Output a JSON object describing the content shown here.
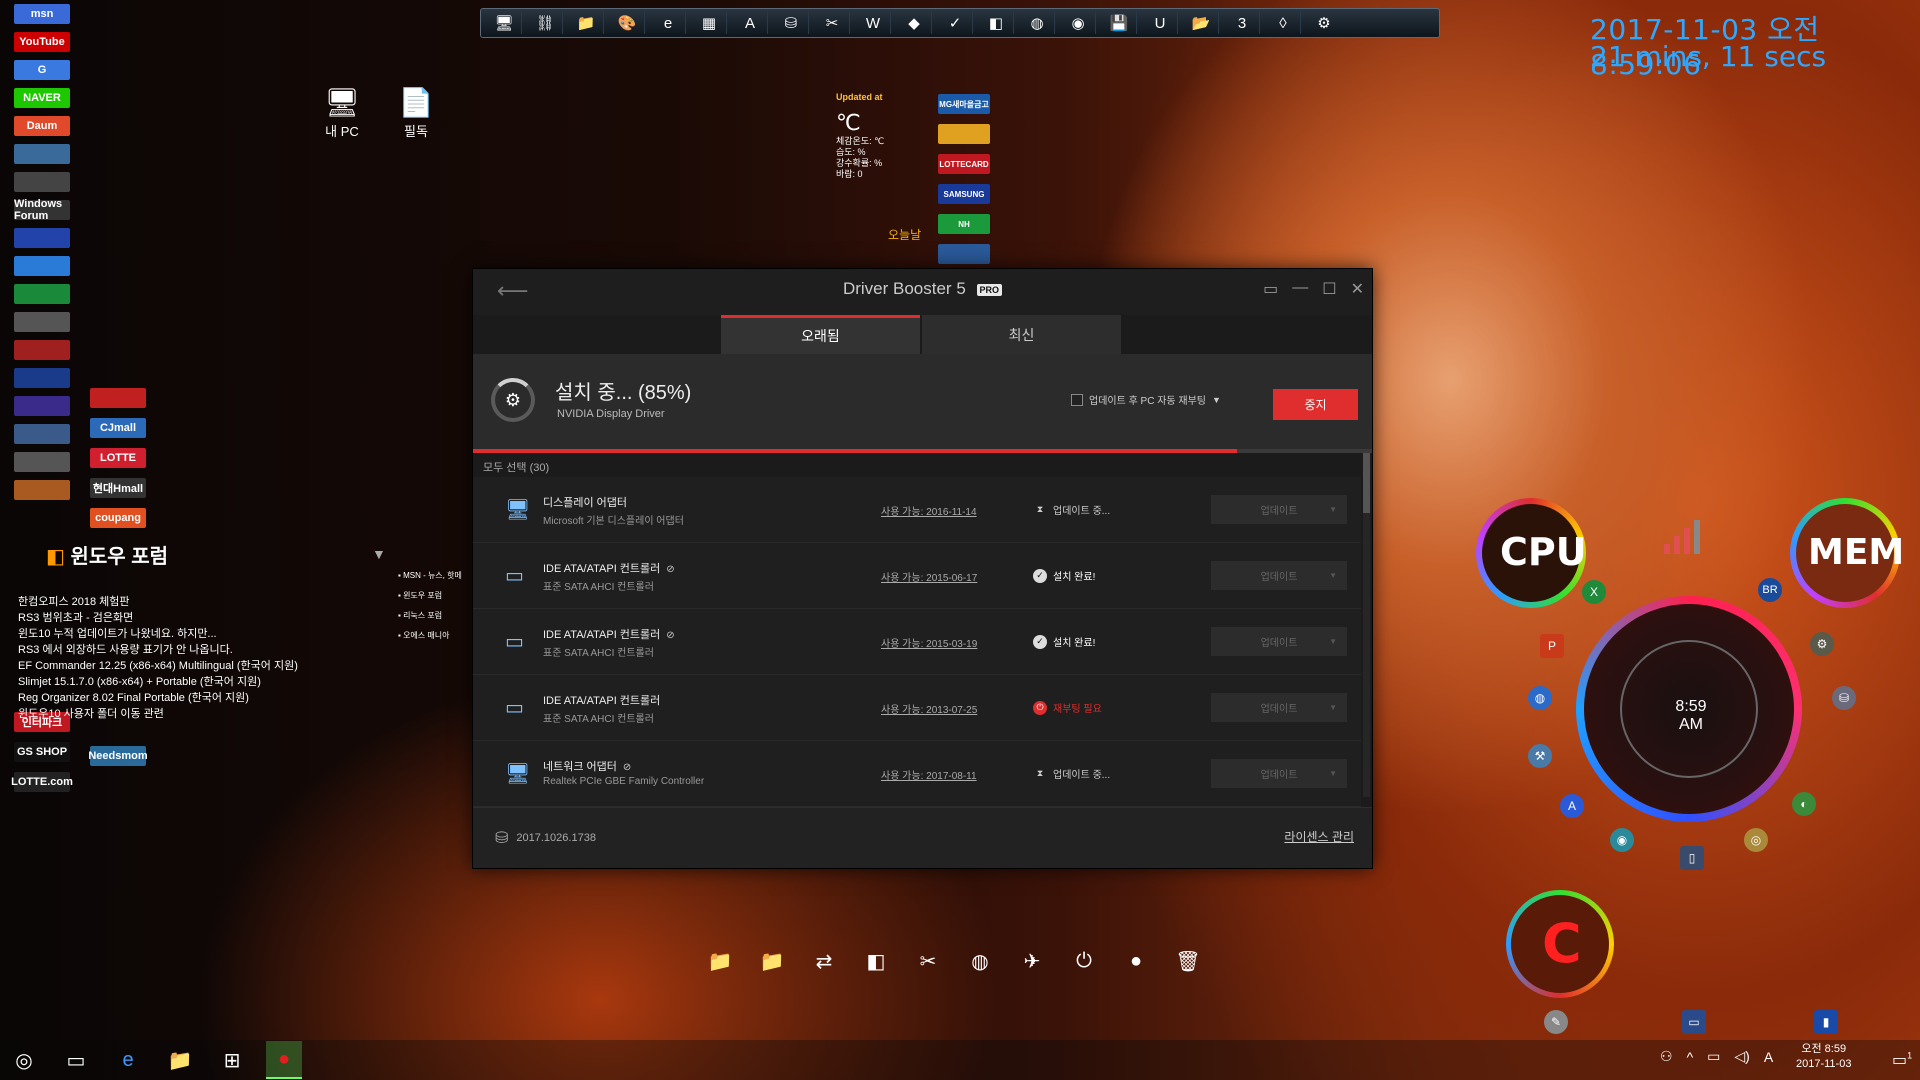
{
  "clock": {
    "datetime": "2017-11-03 오전 8:59:06",
    "uptime": "21 mins, 11 secs"
  },
  "top_toolbar": {
    "icons": [
      "monitor-icon",
      "network-icon",
      "folder-icon",
      "palette-icon",
      "ie-icon",
      "calendar-icon",
      "avast-icon",
      "drive-icon",
      "tools-icon",
      "word-icon",
      "diamond-icon",
      "check-icon",
      "rss-icon",
      "globe-icon",
      "eye-icon",
      "floppy-icon",
      "u-icon",
      "folder-open-icon",
      "calendar3-icon",
      "drop-icon",
      "gear-icon"
    ]
  },
  "left_dock": {
    "logos": [
      {
        "label": "msn",
        "color": "#3a6ad8"
      },
      {
        "label": "YouTube",
        "color": "#cc0000"
      },
      {
        "label": "G",
        "color": "#3a7ae0"
      },
      {
        "label": "NAVER",
        "color": "#1ec800"
      },
      {
        "label": "Daum",
        "color": "#e04a2a"
      },
      {
        "label": "",
        "color": "#3a6a9a"
      },
      {
        "label": "",
        "color": "#444"
      },
      {
        "label": "Windows Forum",
        "color": "#333"
      },
      {
        "label": "",
        "color": "#2244aa"
      },
      {
        "label": "",
        "color": "#2a7ad8"
      },
      {
        "label": "",
        "color": "#1a8a3a"
      },
      {
        "label": "",
        "color": "#555"
      },
      {
        "label": "",
        "color": "#a02020"
      },
      {
        "label": "",
        "color": "#1a3a8a"
      },
      {
        "label": "",
        "color": "#3a2a8a"
      },
      {
        "label": "",
        "color": "#3a5a8a"
      },
      {
        "label": "",
        "color": "#555"
      },
      {
        "label": "",
        "color": "#a85a20"
      }
    ],
    "logos_right": [
      {
        "label": "",
        "color": "#c02020"
      },
      {
        "label": "CJmall",
        "color": "#2a6ab8"
      },
      {
        "label": "LOTTE",
        "color": "#d02030"
      },
      {
        "label": "현대Hmall",
        "color": "#333"
      },
      {
        "label": "coupang",
        "color": "#e05020"
      }
    ],
    "logos_bottom": [
      {
        "label": "인터파크",
        "color": "#c01820"
      },
      {
        "label": "GS SHOP",
        "color": "#111"
      },
      {
        "label": "LOTTE.com",
        "color": "#222"
      }
    ],
    "logos_bottom_right": [
      {
        "label": "Needsmom",
        "color": "#2a6a9a"
      }
    ]
  },
  "desktop_icons": [
    {
      "label": "내 PC",
      "icon": "monitor-icon"
    },
    {
      "label": "필독",
      "icon": "document-icon"
    }
  ],
  "weather": {
    "updated_label": "Updated at",
    "temp": "℃",
    "lines": [
      "체감온도: ℃",
      "습도: %",
      "강수확률: %",
      "바람:  0"
    ],
    "today_label": "오늘날"
  },
  "bank_logos": [
    {
      "label": "MG새마을금고",
      "color": "#1a5aa8"
    },
    {
      "label": "",
      "color": "#e0a020"
    },
    {
      "label": "LOTTECARD",
      "color": "#c01820"
    },
    {
      "label": "SAMSUNG",
      "color": "#1a3a9a"
    },
    {
      "label": "NH",
      "color": "#1a9a3a"
    },
    {
      "label": "",
      "color": "#2a5a9a"
    }
  ],
  "rss": {
    "title": "윈도우 포럼",
    "items": [
      "한컴오피스 2018 체험판",
      "RS3 범위초과 - 검은화면",
      "윈도10 누적 업데이트가 나왔네요. 하지만...",
      "RS3 에서 외장하드 사용량 표기가 안 나옵니다.",
      "EF Commander 12.25 (x86-x64) Multilingual (한국어 지원)",
      "Slimjet 15.1.7.0 (x86-x64) + Portable (한국어 지원)",
      "Reg Organizer 8.02 Final Portable (한국어 지원)",
      "윈도우10 사용자 폴더 이동 관련"
    ],
    "side_items": [
      "MSN - 뉴스, 핫메",
      "윈도우 포럼",
      "리눅스 포럼",
      "오에스 매니아"
    ]
  },
  "app": {
    "title": "Driver Booster 5",
    "pro": "PRO",
    "tabs": [
      {
        "label": "오래됨",
        "active": true
      },
      {
        "label": "최신",
        "active": false
      }
    ],
    "status_main": "설치 중... (85%)",
    "status_sub": "NVIDIA Display Driver",
    "restart_option": "업데이트 후 PC 자동 재부팅",
    "stop_label": "중지",
    "progress_percent": 85,
    "select_all": "모두 선택 (30)",
    "rows": [
      {
        "name": "디스플레이 어댑터",
        "tagged": false,
        "desc": "Microsoft 기본 디스플레이 어댑터",
        "avail": "사용 가능: 2016-11-14",
        "status": "업데이트 중...",
        "status_type": "updating",
        "btn": "업데이트",
        "icon": "display-adapter-icon"
      },
      {
        "name": "IDE ATA/ATAPI 컨트롤러",
        "tagged": true,
        "desc": "표준 SATA AHCI 컨트롤러",
        "avail": "사용 가능: 2015-06-17",
        "status": "설치 완료!",
        "status_type": "done",
        "btn": "업데이트",
        "icon": "storage-controller-icon"
      },
      {
        "name": "IDE ATA/ATAPI 컨트롤러",
        "tagged": true,
        "desc": "표준 SATA AHCI 컨트롤러",
        "avail": "사용 가능: 2015-03-19",
        "status": "설치 완료!",
        "status_type": "done",
        "btn": "업데이트",
        "icon": "storage-controller-icon"
      },
      {
        "name": "IDE ATA/ATAPI 컨트롤러",
        "tagged": false,
        "desc": "표준 SATA AHCI 컨트롤러",
        "avail": "사용 가능: 2013-07-25",
        "status": "재부팅 필요",
        "status_type": "reboot",
        "btn": "업데이트",
        "icon": "storage-controller-icon"
      },
      {
        "name": "네트워크 어댑터",
        "tagged": true,
        "desc": "Realtek PCIe GBE Family Controller",
        "avail": "사용 가능: 2017-08-11",
        "status": "업데이트 중...",
        "status_type": "updating",
        "btn": "업데이트",
        "icon": "network-adapter-icon"
      }
    ],
    "version": "2017.1026.1738",
    "license_label": "라이센스 관리"
  },
  "gadgets": {
    "cpu_label": "CPU",
    "mem_label": "MEM",
    "c_label": "C",
    "mini_clock_time": "8:59",
    "mini_clock_ampm": "AM",
    "br_label": "BR"
  },
  "dock": {
    "icons": [
      "folder-icon",
      "folder-icon",
      "teamviewer-icon",
      "rss-icon",
      "tools-icon",
      "globe-icon",
      "plane-icon",
      "power-icon",
      "lime-icon",
      "trash-icon"
    ]
  },
  "taskbar": {
    "items": [
      "start-icon",
      "task-view-icon",
      "edge-icon",
      "explorer-icon",
      "store-icon",
      "recording-icon"
    ],
    "tray_ime": "A",
    "tray_time": "오전 8:59",
    "tray_date": "2017-11-03",
    "notif_count": "1"
  }
}
